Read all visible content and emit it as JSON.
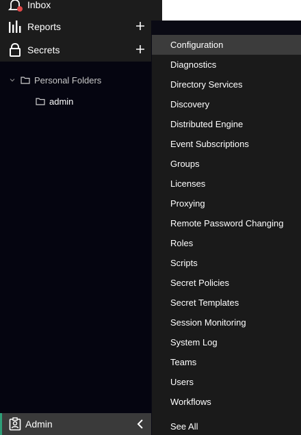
{
  "sidebar": {
    "nav": [
      {
        "label": "Inbox"
      },
      {
        "label": "Reports"
      },
      {
        "label": "Secrets"
      }
    ],
    "tree": {
      "root_label": "Personal Folders",
      "child_label": "admin"
    },
    "admin": {
      "label": "Admin"
    }
  },
  "flyout": {
    "items": [
      {
        "label": "Configuration"
      },
      {
        "label": "Diagnostics"
      },
      {
        "label": "Directory Services"
      },
      {
        "label": "Discovery"
      },
      {
        "label": "Distributed Engine"
      },
      {
        "label": "Event Subscriptions"
      },
      {
        "label": "Groups"
      },
      {
        "label": "Licenses"
      },
      {
        "label": "Proxying"
      },
      {
        "label": "Remote Password Changing"
      },
      {
        "label": "Roles"
      },
      {
        "label": "Scripts"
      },
      {
        "label": "Secret Policies"
      },
      {
        "label": "Secret Templates"
      },
      {
        "label": "Session Monitoring"
      },
      {
        "label": "System Log"
      },
      {
        "label": "Teams"
      },
      {
        "label": "Users"
      },
      {
        "label": "Workflows"
      }
    ],
    "see_all": "See All"
  },
  "colors": {
    "accent": "#2e9e78",
    "notification": "#e04848"
  }
}
